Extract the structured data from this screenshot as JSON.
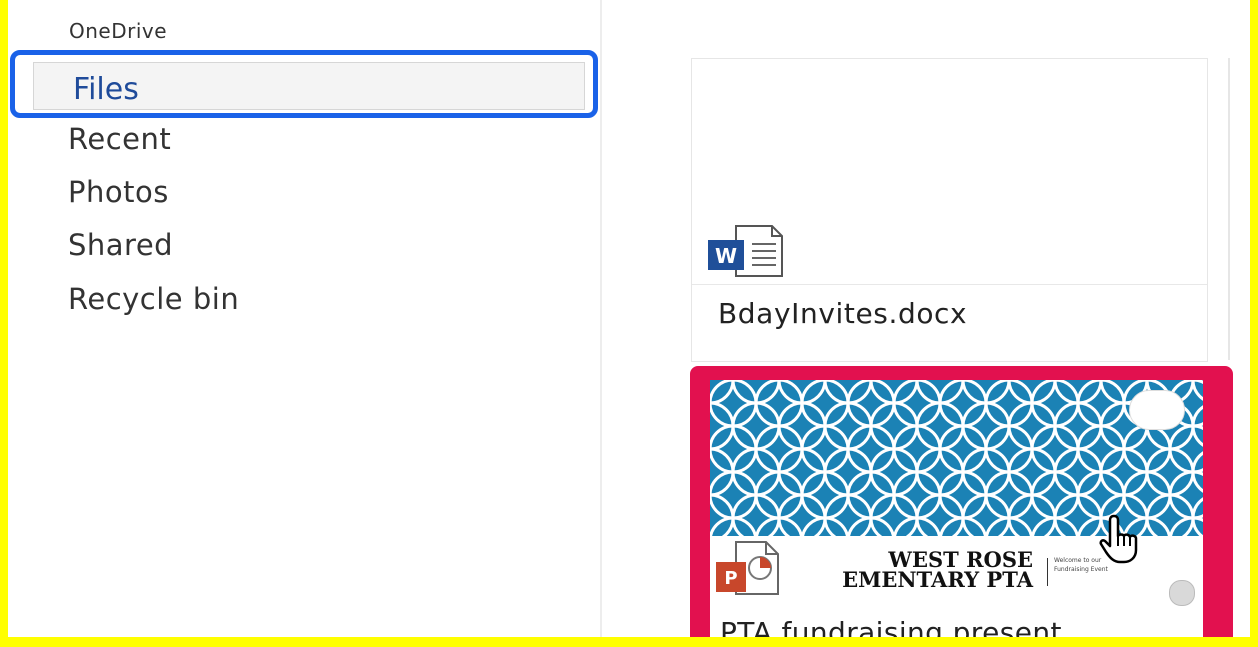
{
  "sidebar": {
    "app_name": "OneDrive",
    "items": [
      {
        "label": "Files",
        "selected": true
      },
      {
        "label": "Recent"
      },
      {
        "label": "Photos"
      },
      {
        "label": "Shared"
      },
      {
        "label": "Recycle bin"
      }
    ]
  },
  "files": [
    {
      "name": "BdayInvites.docx",
      "icon": "word-doc-icon"
    },
    {
      "name": "PTA fundraising present",
      "icon": "powerpoint-icon",
      "thumbnail": {
        "title_line1": "WEST ROSE",
        "title_line2": "EMENTARY PTA",
        "small_text": "Welcome to our Fundraising Event"
      }
    }
  ],
  "colors": {
    "highlight_border_yellow": "#ffff00",
    "selected_nav_border": "#1a62e8",
    "selected_tile_border": "#e2114f",
    "thumbnail_pattern_blue": "#1b82b5"
  }
}
